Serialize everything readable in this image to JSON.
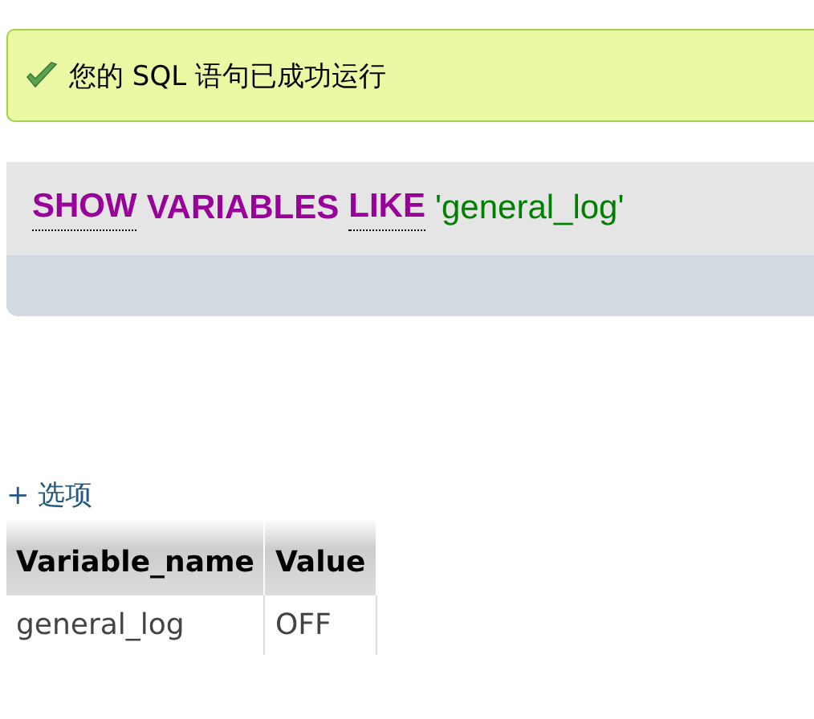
{
  "message": {
    "kind": "success",
    "text": "您的 SQL 语句已成功运行"
  },
  "query": {
    "tokens": [
      {
        "text": "SHOW",
        "kind": "keyword",
        "underlined": true
      },
      {
        "text": "VARIABLES",
        "kind": "keyword",
        "underlined": false
      },
      {
        "text": "LIKE",
        "kind": "keyword",
        "underlined": true
      },
      {
        "text": "'general_log'",
        "kind": "string",
        "underlined": false
      }
    ]
  },
  "options_link": "+ 选项",
  "table": {
    "columns": [
      "Variable_name",
      "Value"
    ],
    "rows": [
      [
        "general_log",
        "OFF"
      ]
    ]
  }
}
